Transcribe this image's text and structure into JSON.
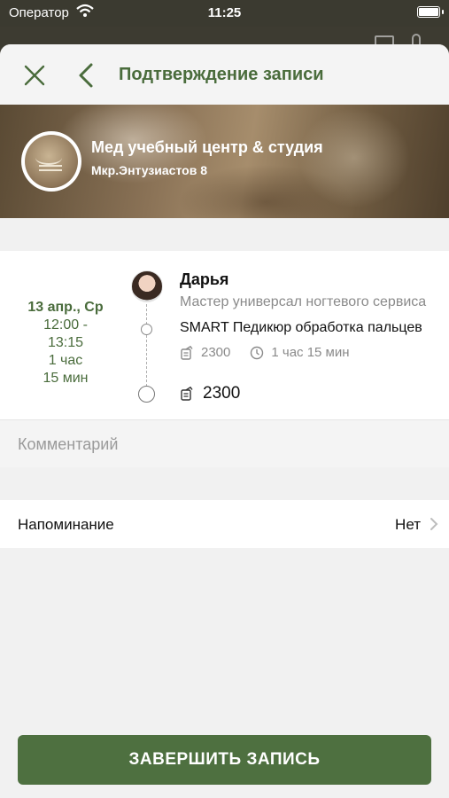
{
  "status_bar": {
    "carrier": "Оператор",
    "time": "11:25"
  },
  "header": {
    "title": "Подтверждение записи"
  },
  "salon": {
    "name": "Мед учебный центр & студия",
    "address": "Мкр.Энтузиастов 8"
  },
  "booking": {
    "date": "13 апр., Ср",
    "time_range": "12:00 - 13:15",
    "duration": "1 час 15 мин",
    "master": {
      "name": "Дарья",
      "role": "Мастер универсал ногтевого сервиса"
    },
    "service": {
      "name": "SMART Педикюр обработка пальцев",
      "price": "2300",
      "duration": "1 час 15 мин"
    },
    "total": "2300"
  },
  "comment": {
    "placeholder": "Комментарий",
    "value": ""
  },
  "reminder": {
    "label": "Напоминание",
    "value": "Нет"
  },
  "actions": {
    "finish_label": "ЗАВЕРШИТЬ ЗАПИСЬ"
  },
  "colors": {
    "accent": "#4e7040",
    "title": "#4a6c3c"
  }
}
